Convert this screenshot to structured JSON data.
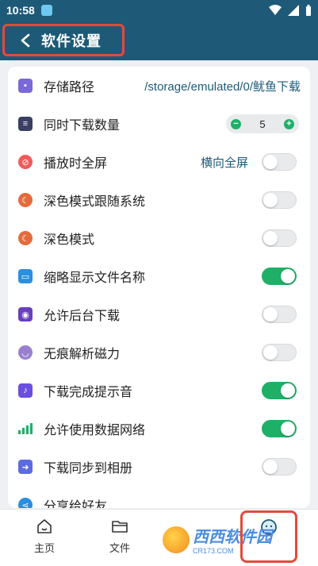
{
  "status": {
    "time": "10:58"
  },
  "header": {
    "title": "软件设置"
  },
  "settings": {
    "storage": {
      "label": "存储路径",
      "path": "/storage/emulated/0/鱿鱼下载"
    },
    "concurrent": {
      "label": "同时下载数量",
      "value": "5",
      "minus": "−",
      "plus": "+"
    },
    "fullscreen": {
      "label": "播放时全屏",
      "value": "横向全屏",
      "enabled": false
    },
    "dark_follow": {
      "label": "深色模式跟随系统",
      "enabled": false
    },
    "dark_mode": {
      "label": "深色模式",
      "enabled": false
    },
    "thumb_name": {
      "label": "缩略显示文件名称",
      "enabled": true
    },
    "bg_download": {
      "label": "允许后台下载",
      "enabled": false
    },
    "magnet": {
      "label": "无痕解析磁力",
      "enabled": false
    },
    "sound": {
      "label": "下载完成提示音",
      "enabled": true
    },
    "mobile_data": {
      "label": "允许使用数据网络",
      "enabled": true
    },
    "album_sync": {
      "label": "下载同步到相册",
      "enabled": false
    },
    "share": {
      "label": "分享给好友"
    }
  },
  "nav": {
    "home": "主页",
    "files": "文件"
  },
  "watermark": {
    "text": "西西软件园",
    "sub": "CR173.COM"
  },
  "colors": {
    "primary": "#1e5a78",
    "toggle_on": "#1fb068",
    "highlight": "#e24b3b"
  }
}
